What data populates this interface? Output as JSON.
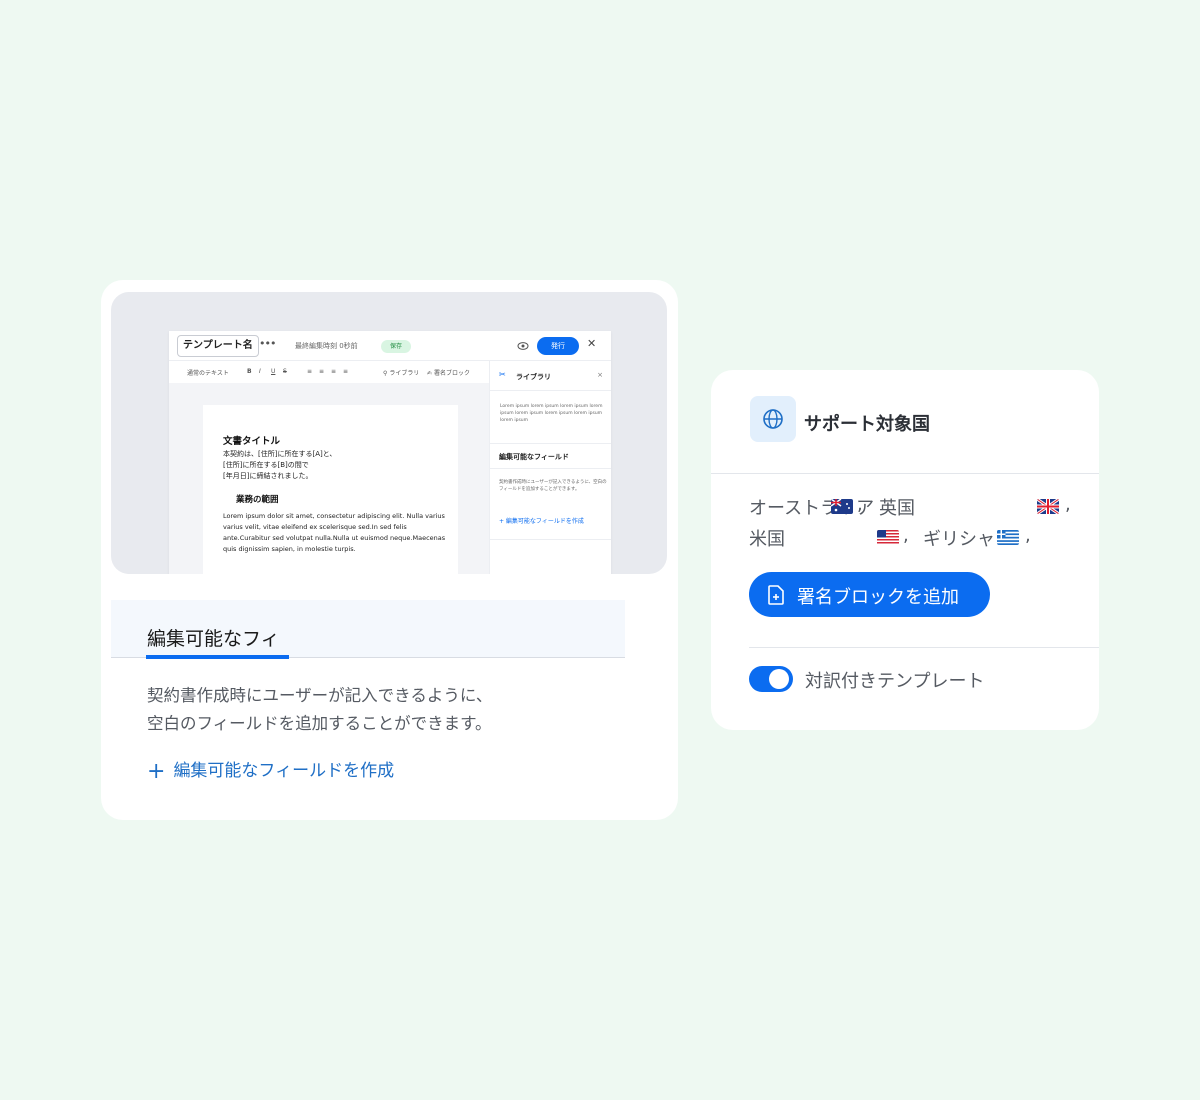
{
  "editor": {
    "template_name": "テンプレート名",
    "more": "•••",
    "last_edited": "最終編集時刻   0秒前",
    "saved_badge": "保存",
    "publish_button": "発行",
    "close": "✕",
    "toolbar": {
      "style": "通常のテキスト",
      "bold": "B",
      "italic": "I",
      "underline": "U",
      "strike": "S",
      "library": "ライブラリ",
      "signature_block": "署名ブロック"
    },
    "document": {
      "title": "文書タイトル",
      "paragraph": "本契約は、[住所]に所在する[A]と、\n[住所]に所在する[B]の間で\n[年月日]に締結されました。",
      "subtitle": "業務の範囲",
      "lorem": "Lorem ipsum dolor sit amet, consectetur adipiscing elit. Nulla varius varius velit, vitae eleifend ex scelerisque sed.In sed felis ante.Curabitur sed volutpat nulla.Nulla ut euismod neque.Maecenas quis dignissim sapien, in molestie turpis."
    },
    "side_panel": {
      "title": "ライブラリ",
      "close": "×",
      "lorem": "Lorem ipsum lorem ipsum lorem ipsum lorem ipsum lorem ipsum lorem ipsum lorem ipsum lorem ipsum",
      "section_title": "編集可能なフィールド",
      "section_desc": "契約書作成時にユーザーが記入できるように、空白のフィールドを追加することができます。",
      "create_link": "+ 編集可能なフィールドを作成"
    }
  },
  "feature_card": {
    "tab_label": "編集可能なフィ",
    "description": "契約書作成時にユーザーが記入できるように、\n空白のフィールドを追加することができます。",
    "create_link": "編集可能なフィールドを作成"
  },
  "countries_card": {
    "title": "サポート対象国",
    "line1": {
      "a": "オーストラリア",
      "b": "英国",
      "sep": ","
    },
    "line2": {
      "a": "米国",
      "sep1": ",",
      "b": "ギリシャ",
      "sep2": ","
    },
    "add_button": "署名ブロックを追加",
    "toggle_label": "対訳付きテンプレート",
    "toggle_on": true
  },
  "colors": {
    "accent": "#0b6cf0",
    "background": "#eef9f2"
  }
}
